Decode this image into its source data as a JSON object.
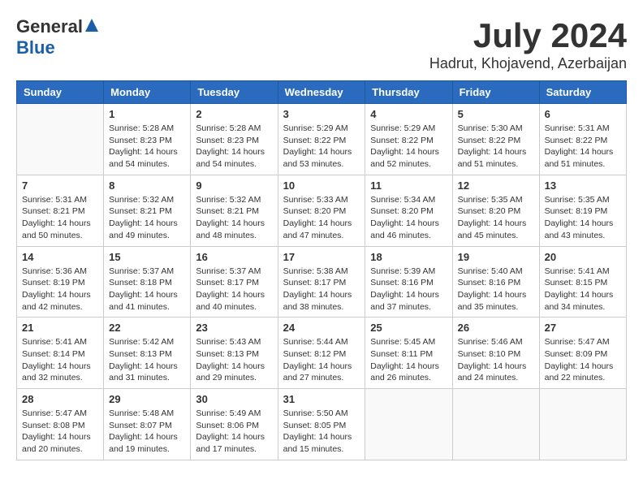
{
  "header": {
    "logo_general": "General",
    "logo_blue": "Blue",
    "month_title": "July 2024",
    "subtitle": "Hadrut, Khojavend, Azerbaijan"
  },
  "calendar": {
    "days_of_week": [
      "Sunday",
      "Monday",
      "Tuesday",
      "Wednesday",
      "Thursday",
      "Friday",
      "Saturday"
    ],
    "weeks": [
      [
        {
          "day": "",
          "info": ""
        },
        {
          "day": "1",
          "info": "Sunrise: 5:28 AM\nSunset: 8:23 PM\nDaylight: 14 hours\nand 54 minutes."
        },
        {
          "day": "2",
          "info": "Sunrise: 5:28 AM\nSunset: 8:23 PM\nDaylight: 14 hours\nand 54 minutes."
        },
        {
          "day": "3",
          "info": "Sunrise: 5:29 AM\nSunset: 8:22 PM\nDaylight: 14 hours\nand 53 minutes."
        },
        {
          "day": "4",
          "info": "Sunrise: 5:29 AM\nSunset: 8:22 PM\nDaylight: 14 hours\nand 52 minutes."
        },
        {
          "day": "5",
          "info": "Sunrise: 5:30 AM\nSunset: 8:22 PM\nDaylight: 14 hours\nand 51 minutes."
        },
        {
          "day": "6",
          "info": "Sunrise: 5:31 AM\nSunset: 8:22 PM\nDaylight: 14 hours\nand 51 minutes."
        }
      ],
      [
        {
          "day": "7",
          "info": "Sunrise: 5:31 AM\nSunset: 8:21 PM\nDaylight: 14 hours\nand 50 minutes."
        },
        {
          "day": "8",
          "info": "Sunrise: 5:32 AM\nSunset: 8:21 PM\nDaylight: 14 hours\nand 49 minutes."
        },
        {
          "day": "9",
          "info": "Sunrise: 5:32 AM\nSunset: 8:21 PM\nDaylight: 14 hours\nand 48 minutes."
        },
        {
          "day": "10",
          "info": "Sunrise: 5:33 AM\nSunset: 8:20 PM\nDaylight: 14 hours\nand 47 minutes."
        },
        {
          "day": "11",
          "info": "Sunrise: 5:34 AM\nSunset: 8:20 PM\nDaylight: 14 hours\nand 46 minutes."
        },
        {
          "day": "12",
          "info": "Sunrise: 5:35 AM\nSunset: 8:20 PM\nDaylight: 14 hours\nand 45 minutes."
        },
        {
          "day": "13",
          "info": "Sunrise: 5:35 AM\nSunset: 8:19 PM\nDaylight: 14 hours\nand 43 minutes."
        }
      ],
      [
        {
          "day": "14",
          "info": "Sunrise: 5:36 AM\nSunset: 8:19 PM\nDaylight: 14 hours\nand 42 minutes."
        },
        {
          "day": "15",
          "info": "Sunrise: 5:37 AM\nSunset: 8:18 PM\nDaylight: 14 hours\nand 41 minutes."
        },
        {
          "day": "16",
          "info": "Sunrise: 5:37 AM\nSunset: 8:17 PM\nDaylight: 14 hours\nand 40 minutes."
        },
        {
          "day": "17",
          "info": "Sunrise: 5:38 AM\nSunset: 8:17 PM\nDaylight: 14 hours\nand 38 minutes."
        },
        {
          "day": "18",
          "info": "Sunrise: 5:39 AM\nSunset: 8:16 PM\nDaylight: 14 hours\nand 37 minutes."
        },
        {
          "day": "19",
          "info": "Sunrise: 5:40 AM\nSunset: 8:16 PM\nDaylight: 14 hours\nand 35 minutes."
        },
        {
          "day": "20",
          "info": "Sunrise: 5:41 AM\nSunset: 8:15 PM\nDaylight: 14 hours\nand 34 minutes."
        }
      ],
      [
        {
          "day": "21",
          "info": "Sunrise: 5:41 AM\nSunset: 8:14 PM\nDaylight: 14 hours\nand 32 minutes."
        },
        {
          "day": "22",
          "info": "Sunrise: 5:42 AM\nSunset: 8:13 PM\nDaylight: 14 hours\nand 31 minutes."
        },
        {
          "day": "23",
          "info": "Sunrise: 5:43 AM\nSunset: 8:13 PM\nDaylight: 14 hours\nand 29 minutes."
        },
        {
          "day": "24",
          "info": "Sunrise: 5:44 AM\nSunset: 8:12 PM\nDaylight: 14 hours\nand 27 minutes."
        },
        {
          "day": "25",
          "info": "Sunrise: 5:45 AM\nSunset: 8:11 PM\nDaylight: 14 hours\nand 26 minutes."
        },
        {
          "day": "26",
          "info": "Sunrise: 5:46 AM\nSunset: 8:10 PM\nDaylight: 14 hours\nand 24 minutes."
        },
        {
          "day": "27",
          "info": "Sunrise: 5:47 AM\nSunset: 8:09 PM\nDaylight: 14 hours\nand 22 minutes."
        }
      ],
      [
        {
          "day": "28",
          "info": "Sunrise: 5:47 AM\nSunset: 8:08 PM\nDaylight: 14 hours\nand 20 minutes."
        },
        {
          "day": "29",
          "info": "Sunrise: 5:48 AM\nSunset: 8:07 PM\nDaylight: 14 hours\nand 19 minutes."
        },
        {
          "day": "30",
          "info": "Sunrise: 5:49 AM\nSunset: 8:06 PM\nDaylight: 14 hours\nand 17 minutes."
        },
        {
          "day": "31",
          "info": "Sunrise: 5:50 AM\nSunset: 8:05 PM\nDaylight: 14 hours\nand 15 minutes."
        },
        {
          "day": "",
          "info": ""
        },
        {
          "day": "",
          "info": ""
        },
        {
          "day": "",
          "info": ""
        }
      ]
    ]
  }
}
